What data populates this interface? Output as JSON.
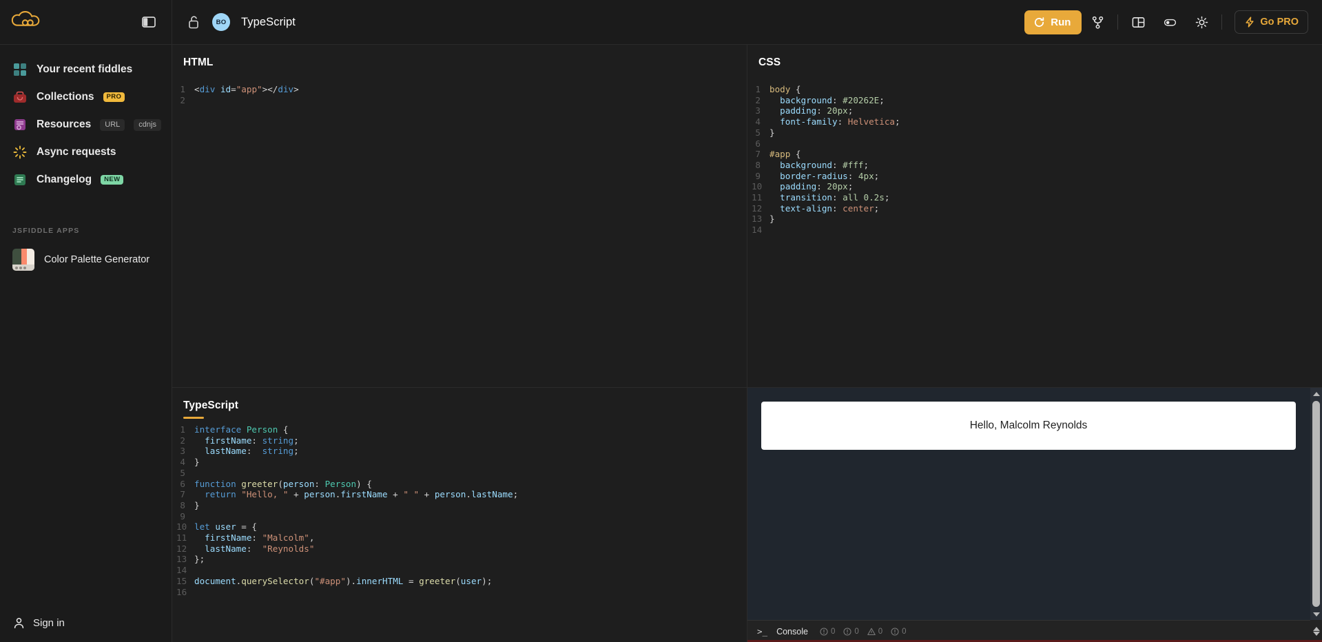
{
  "topbar": {
    "panel_toggle_icon": "panel-left-icon",
    "lock_icon": "unlock-icon",
    "avatar_initials": "BO",
    "fiddle_title": "TypeScript",
    "run_label": "Run",
    "run_icon": "refresh-icon",
    "fork_icon": "fork-icon",
    "layout_icon": "layout-icon",
    "toggle_icon": "toggle-switch-icon",
    "theme_icon": "sun-icon",
    "gopro_label": "Go PRO",
    "gopro_icon": "lightning-bolt-icon",
    "accent_color": "#e8a93a"
  },
  "sidebar": {
    "items": [
      {
        "label": "Your recent fiddles",
        "icon": "grid-squares-icon",
        "badges": []
      },
      {
        "label": "Collections",
        "icon": "bag-icon",
        "badges": [
          {
            "text": "PRO",
            "style": "pro"
          }
        ]
      },
      {
        "label": "Resources",
        "icon": "document-stack-icon",
        "badges": [
          {
            "text": "URL",
            "style": "plain"
          },
          {
            "text": "cdnjs",
            "style": "plain"
          }
        ]
      },
      {
        "label": "Async requests",
        "icon": "spinner-icon",
        "badges": []
      },
      {
        "label": "Changelog",
        "icon": "list-lines-icon",
        "badges": [
          {
            "text": "NEW",
            "style": "new"
          }
        ]
      }
    ],
    "section_title": "JSFIDDLE APPS",
    "apps": [
      {
        "name": "Color Palette Generator",
        "thumb_colors": [
          "#3f4f3f",
          "#fa8a6c",
          "#f3ece3"
        ]
      }
    ],
    "signin_label": "Sign in",
    "signin_icon": "person-icon"
  },
  "panes": {
    "html": {
      "title": "HTML",
      "lines": [
        [
          {
            "t": "<",
            "c": "t-pun"
          },
          {
            "t": "div",
            "c": "t-tag"
          },
          {
            "t": " ",
            "c": "t-plain"
          },
          {
            "t": "id",
            "c": "t-attr"
          },
          {
            "t": "=",
            "c": "t-pun"
          },
          {
            "t": "\"app\"",
            "c": "t-str"
          },
          {
            "t": ">",
            "c": "t-pun"
          },
          {
            "t": "</",
            "c": "t-pun"
          },
          {
            "t": "div",
            "c": "t-tag"
          },
          {
            "t": ">",
            "c": "t-pun"
          }
        ],
        []
      ]
    },
    "css": {
      "title": "CSS",
      "lines": [
        [
          {
            "t": "body ",
            "c": "t-sel"
          },
          {
            "t": "{",
            "c": "t-pun"
          }
        ],
        [
          {
            "t": "  background",
            "c": "t-prop"
          },
          {
            "t": ": ",
            "c": "t-pun"
          },
          {
            "t": "#20262E",
            "c": "t-num"
          },
          {
            "t": ";",
            "c": "t-pun"
          }
        ],
        [
          {
            "t": "  padding",
            "c": "t-prop"
          },
          {
            "t": ": ",
            "c": "t-pun"
          },
          {
            "t": "20px",
            "c": "t-num"
          },
          {
            "t": ";",
            "c": "t-pun"
          }
        ],
        [
          {
            "t": "  font-family",
            "c": "t-prop"
          },
          {
            "t": ": ",
            "c": "t-pun"
          },
          {
            "t": "Helvetica",
            "c": "t-val"
          },
          {
            "t": ";",
            "c": "t-pun"
          }
        ],
        [
          {
            "t": "}",
            "c": "t-pun"
          }
        ],
        [],
        [
          {
            "t": "#app ",
            "c": "t-sel"
          },
          {
            "t": "{",
            "c": "t-pun"
          }
        ],
        [
          {
            "t": "  background",
            "c": "t-prop"
          },
          {
            "t": ": ",
            "c": "t-pun"
          },
          {
            "t": "#fff",
            "c": "t-num"
          },
          {
            "t": ";",
            "c": "t-pun"
          }
        ],
        [
          {
            "t": "  border-radius",
            "c": "t-prop"
          },
          {
            "t": ": ",
            "c": "t-pun"
          },
          {
            "t": "4px",
            "c": "t-num"
          },
          {
            "t": ";",
            "c": "t-pun"
          }
        ],
        [
          {
            "t": "  padding",
            "c": "t-prop"
          },
          {
            "t": ": ",
            "c": "t-pun"
          },
          {
            "t": "20px",
            "c": "t-num"
          },
          {
            "t": ";",
            "c": "t-pun"
          }
        ],
        [
          {
            "t": "  transition",
            "c": "t-prop"
          },
          {
            "t": ": ",
            "c": "t-pun"
          },
          {
            "t": "all 0.2s",
            "c": "t-num"
          },
          {
            "t": ";",
            "c": "t-pun"
          }
        ],
        [
          {
            "t": "  text-align",
            "c": "t-prop"
          },
          {
            "t": ": ",
            "c": "t-pun"
          },
          {
            "t": "center",
            "c": "t-val"
          },
          {
            "t": ";",
            "c": "t-pun"
          }
        ],
        [
          {
            "t": "}",
            "c": "t-pun"
          }
        ],
        []
      ]
    },
    "typescript": {
      "title": "TypeScript",
      "lines": [
        [
          {
            "t": "interface ",
            "c": "t-kw"
          },
          {
            "t": "Person",
            "c": "t-typ"
          },
          {
            "t": " {",
            "c": "t-pun"
          }
        ],
        [
          {
            "t": "  firstName",
            "c": "t-var"
          },
          {
            "t": ": ",
            "c": "t-pun"
          },
          {
            "t": "string",
            "c": "t-kw"
          },
          {
            "t": ";",
            "c": "t-pun"
          }
        ],
        [
          {
            "t": "  lastName",
            "c": "t-var"
          },
          {
            "t": ":  ",
            "c": "t-pun"
          },
          {
            "t": "string",
            "c": "t-kw"
          },
          {
            "t": ";",
            "c": "t-pun"
          }
        ],
        [
          {
            "t": "}",
            "c": "t-pun"
          }
        ],
        [],
        [
          {
            "t": "function ",
            "c": "t-kw"
          },
          {
            "t": "greeter",
            "c": "t-fn"
          },
          {
            "t": "(",
            "c": "t-pun"
          },
          {
            "t": "person",
            "c": "t-var"
          },
          {
            "t": ": ",
            "c": "t-pun"
          },
          {
            "t": "Person",
            "c": "t-typ"
          },
          {
            "t": ") {",
            "c": "t-pun"
          }
        ],
        [
          {
            "t": "  return ",
            "c": "t-kw"
          },
          {
            "t": "\"Hello, \"",
            "c": "t-str"
          },
          {
            "t": " + ",
            "c": "t-pun"
          },
          {
            "t": "person",
            "c": "t-var"
          },
          {
            "t": ".",
            "c": "t-pun"
          },
          {
            "t": "firstName",
            "c": "t-var"
          },
          {
            "t": " + ",
            "c": "t-pun"
          },
          {
            "t": "\" \"",
            "c": "t-str"
          },
          {
            "t": " + ",
            "c": "t-pun"
          },
          {
            "t": "person",
            "c": "t-var"
          },
          {
            "t": ".",
            "c": "t-pun"
          },
          {
            "t": "lastName",
            "c": "t-var"
          },
          {
            "t": ";",
            "c": "t-pun"
          }
        ],
        [
          {
            "t": "}",
            "c": "t-pun"
          }
        ],
        [],
        [
          {
            "t": "let ",
            "c": "t-kw"
          },
          {
            "t": "user",
            "c": "t-var"
          },
          {
            "t": " = {",
            "c": "t-pun"
          }
        ],
        [
          {
            "t": "  firstName",
            "c": "t-var"
          },
          {
            "t": ": ",
            "c": "t-pun"
          },
          {
            "t": "\"Malcolm\"",
            "c": "t-str"
          },
          {
            "t": ",",
            "c": "t-pun"
          }
        ],
        [
          {
            "t": "  lastName",
            "c": "t-var"
          },
          {
            "t": ":  ",
            "c": "t-pun"
          },
          {
            "t": "\"Reynolds\"",
            "c": "t-str"
          }
        ],
        [
          {
            "t": "};",
            "c": "t-pun"
          }
        ],
        [],
        [
          {
            "t": "document",
            "c": "t-var"
          },
          {
            "t": ".",
            "c": "t-pun"
          },
          {
            "t": "querySelector",
            "c": "t-fn"
          },
          {
            "t": "(",
            "c": "t-pun"
          },
          {
            "t": "\"#app\"",
            "c": "t-str"
          },
          {
            "t": ")",
            "c": "t-pun"
          },
          {
            "t": ".",
            "c": "t-pun"
          },
          {
            "t": "innerHTML",
            "c": "t-var"
          },
          {
            "t": " = ",
            "c": "t-pun"
          },
          {
            "t": "greeter",
            "c": "t-fn"
          },
          {
            "t": "(",
            "c": "t-pun"
          },
          {
            "t": "user",
            "c": "t-var"
          },
          {
            "t": ");",
            "c": "t-pun"
          }
        ],
        []
      ]
    }
  },
  "result": {
    "output_text": "Hello, Malcolm Reynolds",
    "background_color": "#20262E",
    "card_background": "#ffffff"
  },
  "console": {
    "prompt_glyph": ">_",
    "label": "Console",
    "counters": [
      {
        "icon": "info-circle-icon",
        "value": "0"
      },
      {
        "icon": "error-circle-icon",
        "value": "0"
      },
      {
        "icon": "warning-triangle-icon",
        "value": "0"
      },
      {
        "icon": "debug-circle-icon",
        "value": "0"
      }
    ]
  }
}
